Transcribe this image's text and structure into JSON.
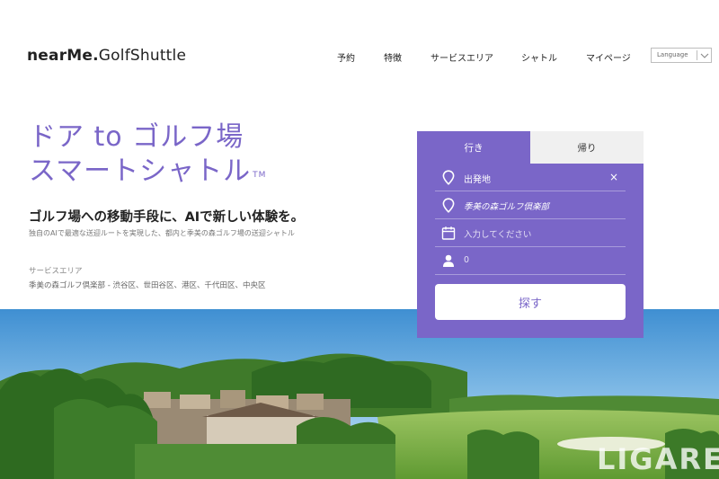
{
  "logo": {
    "bold": "nearMe.",
    "light": "GolfShuttle"
  },
  "nav": {
    "items": [
      "予約",
      "特徴",
      "サービスエリア",
      "シャトル",
      "マイページ"
    ],
    "language": "Language"
  },
  "hero": {
    "title_line1": "ドア to ゴルフ場",
    "title_line2": "スマートシャトル",
    "tm": "TM",
    "tagline": "ゴルフ場への移動手段に、AIで新しい体験を。",
    "subtext": "独自のAIで最適な送迎ルートを実現した、都内と季美の森ゴルフ場の送迎シャトル",
    "area_label": "サービスエリア",
    "area_value": "季美の森ゴルフ倶楽部 - 渋谷区、世田谷区、港区、千代田区、中央区"
  },
  "booking": {
    "tab_outbound": "行き",
    "tab_return": "帰り",
    "origin_placeholder": "出発地",
    "destination": "季美の森ゴルフ倶楽部",
    "date_placeholder": "入力してください",
    "passengers": "0",
    "search_label": "探す",
    "clear_symbol": "×"
  },
  "watermark": "LIGARE",
  "colors": {
    "accent": "#7a66c8",
    "tab_inactive": "#f0f0f0"
  },
  "icons": [
    "location-pin-icon",
    "calendar-icon",
    "person-icon",
    "close-icon",
    "chevron-down-icon"
  ]
}
